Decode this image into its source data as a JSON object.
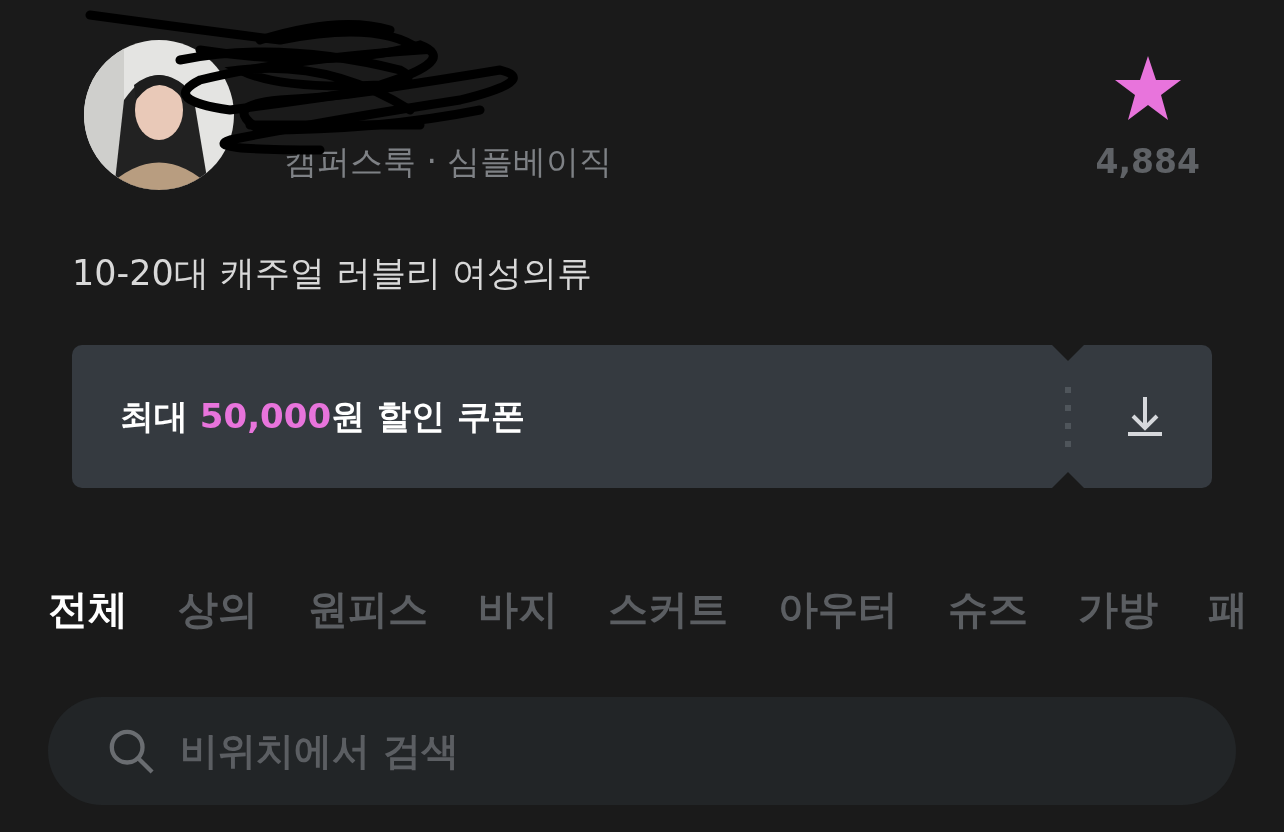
{
  "shop": {
    "tags": "캠퍼스룩 · 심플베이직",
    "favorite": {
      "on": true,
      "count": "4,884"
    },
    "description": "10-20대 캐주얼 러블리 여성의류"
  },
  "coupon": {
    "prefix": "최대 ",
    "amount": "50,000",
    "suffix": "원 할인 쿠폰"
  },
  "tabs": [
    {
      "label": "전체",
      "selected": true
    },
    {
      "label": "상의",
      "selected": false
    },
    {
      "label": "원피스",
      "selected": false
    },
    {
      "label": "바지",
      "selected": false
    },
    {
      "label": "스커트",
      "selected": false
    },
    {
      "label": "아우터",
      "selected": false
    },
    {
      "label": "슈즈",
      "selected": false
    },
    {
      "label": "가방",
      "selected": false
    },
    {
      "label": "패",
      "selected": false
    }
  ],
  "search": {
    "placeholder": "비위치에서 검색"
  }
}
